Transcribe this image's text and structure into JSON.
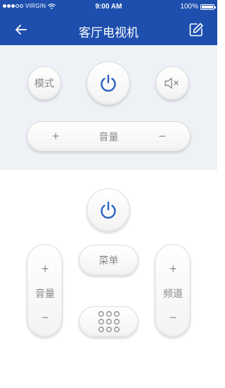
{
  "status_bar": {
    "carrier": "VIRGIN",
    "time": "9:00 AM",
    "battery": "100%"
  },
  "header": {
    "title": "客厅电视机",
    "back_icon": "arrow-left-icon",
    "edit_icon": "edit-square-icon"
  },
  "top_panel": {
    "mode_label": "模式",
    "power_icon": "power-icon",
    "mute_icon": "speaker-mute-icon",
    "volume": {
      "plus": "+",
      "label": "音量",
      "minus": "−"
    }
  },
  "bottom_panel": {
    "power_icon": "power-icon",
    "volume": {
      "plus": "+",
      "label": "音量",
      "minus": "−"
    },
    "menu_label": "菜单",
    "keypad_icon": "number-keypad-icon",
    "channel": {
      "plus": "+",
      "label": "频道",
      "minus": "−"
    }
  },
  "colors": {
    "brand_blue": "#1e4fae",
    "panel_bg": "#eef2f7",
    "power_blue": "#2a62c0"
  }
}
